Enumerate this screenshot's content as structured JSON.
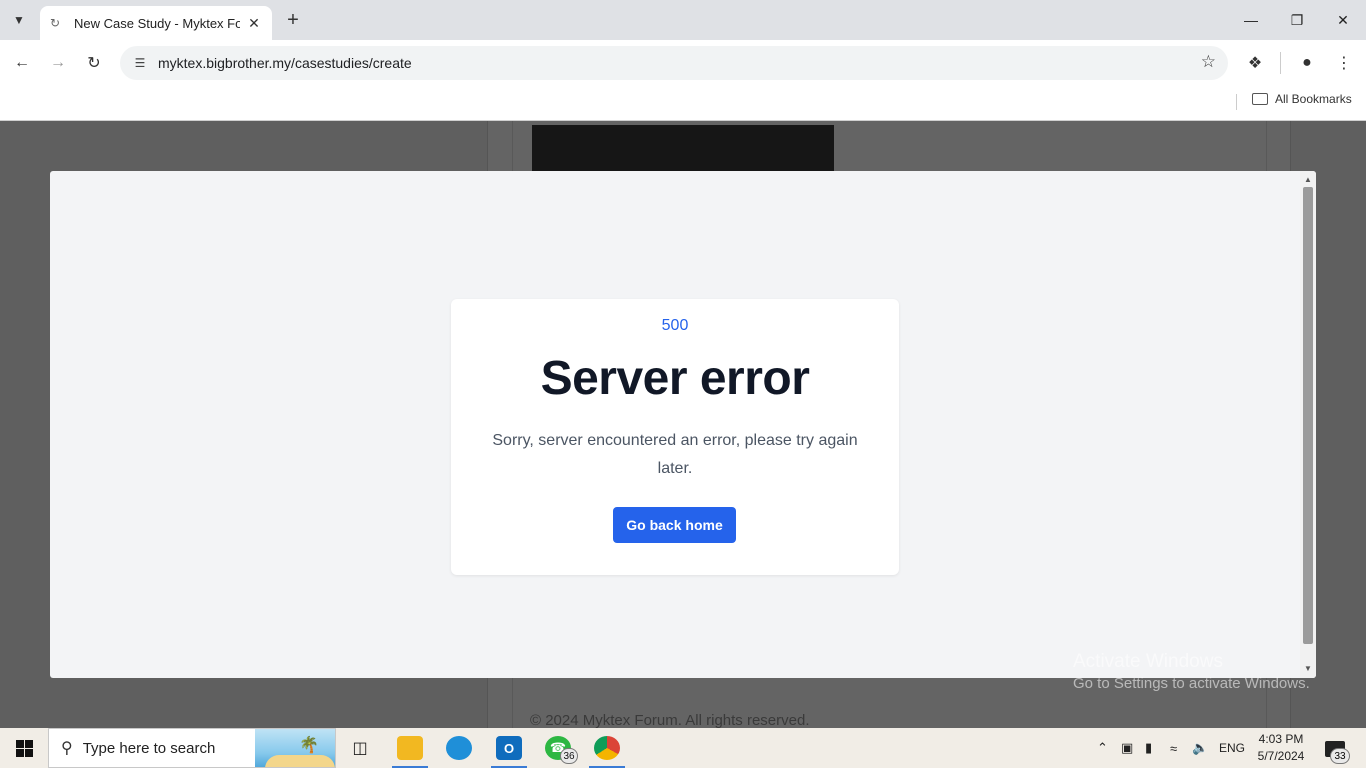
{
  "browser": {
    "tab_title": "New Case Study - Myktex Forum",
    "url": "myktex.bigbrother.my/casestudies/create",
    "bookmarks_label": "All Bookmarks"
  },
  "page": {
    "footer": "© 2024 Myktex Forum. All rights reserved."
  },
  "error": {
    "code": "500",
    "heading": "Server error",
    "message": "Sorry, server encountered an error, please try again later.",
    "button_label": "Go back home"
  },
  "watermark": {
    "line1": "Activate Windows",
    "line2": "Go to Settings to activate Windows."
  },
  "taskbar": {
    "search_placeholder": "Type here to search",
    "whatsapp_badge": "36",
    "language": "ENG",
    "time": "4:03 PM",
    "date": "5/7/2024",
    "notification_count": "33"
  },
  "colors": {
    "accent": "#2563eb",
    "heading": "#111827",
    "modal_bg": "#f3f4f6"
  }
}
